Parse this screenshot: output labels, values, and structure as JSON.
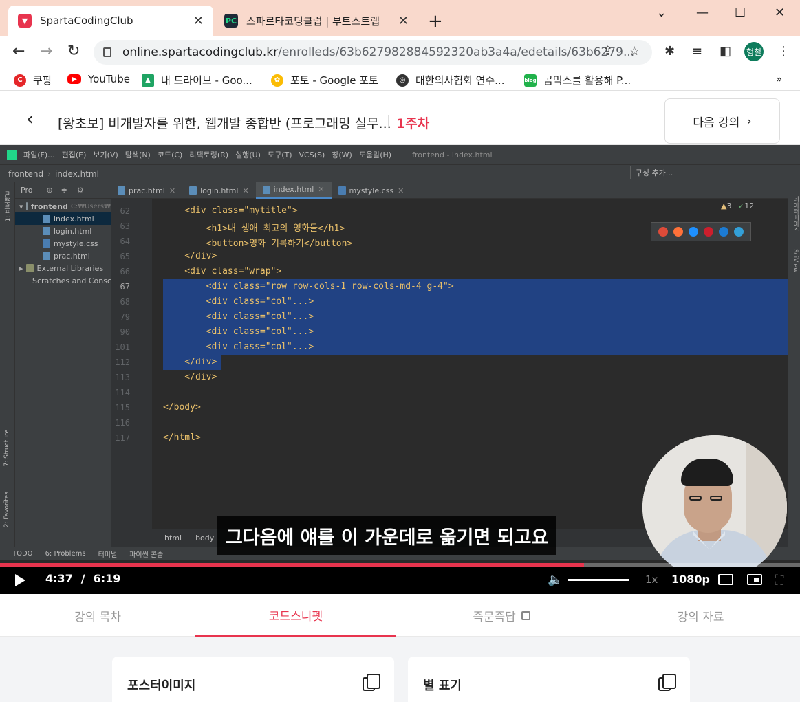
{
  "browser": {
    "tabs": [
      {
        "title": "SpartaCodingClub",
        "active": true
      },
      {
        "title": "스파르타코딩클럽 | 부트스트랩",
        "active": false
      }
    ],
    "url_host": "online.spartacodingclub.kr",
    "url_path": "/enrolleds/63b627982884592320ab3a4a/edetails/63b6279...",
    "profile_initial": "형철",
    "bookmarks": [
      "쿠팡",
      "YouTube",
      "내 드라이브 - Goo...",
      "포토 - Google 포토",
      "대한의사협회 연수...",
      "곰믹스를 활용해 P..."
    ],
    "more_bookmarks": "»"
  },
  "course": {
    "title": "[왕초보] 비개발자를 위한, 웹개발 종합반 (프로그래밍 실무...",
    "week": "1주차",
    "next_label": "다음 강의"
  },
  "ide": {
    "menu": [
      "파일(F)...",
      "편집(E)",
      "보기(V)",
      "탐색(N)",
      "코드(C)",
      "리팩토링(R)",
      "실행(U)",
      "도구(T)",
      "VCS(S)",
      "창(W)",
      "도움말(H)"
    ],
    "window_title": "frontend - index.html",
    "breadcrumb_project": "frontend",
    "breadcrumb_file": "index.html",
    "run_config": "구성 추가...",
    "project_label": "Pro",
    "tree": [
      {
        "label": "frontend",
        "hint": "C:₩Users₩",
        "level": 0
      },
      {
        "label": "index.html",
        "level": 1,
        "selected": true
      },
      {
        "label": "login.html",
        "level": 1
      },
      {
        "label": "mystyle.css",
        "level": 1
      },
      {
        "label": "prac.html",
        "level": 1
      },
      {
        "label": "External Libraries",
        "level": 0
      },
      {
        "label": "Scratches and Consc",
        "level": 0
      }
    ],
    "tabs": [
      "prac.html",
      "login.html",
      "index.html",
      "mystyle.css"
    ],
    "active_tab": "index.html",
    "warnings": "3",
    "checks": "12",
    "crumbs": [
      "html",
      "body"
    ],
    "bottom_tools": [
      "TODO",
      "6: Problems",
      "터미널",
      "파이썬 콘솔"
    ],
    "side_left": [
      "1: 프로젝트",
      "7: Structure",
      "2: Favorites"
    ],
    "side_right": [
      "데이터베이스",
      "SciView"
    ],
    "lines": [
      {
        "n": "62",
        "code": "    <div class=\"mytitle\">"
      },
      {
        "n": "63",
        "code": "        <h1>내 생애 최고의 영화들</h1>"
      },
      {
        "n": "64",
        "code": "        <button>영화 기록하기</button>"
      },
      {
        "n": "65",
        "code": "    </div>"
      },
      {
        "n": "66",
        "code": "    <div class=\"wrap\">"
      },
      {
        "n": "67",
        "code": "        <div class=\"row row-cols-1 row-cols-md-4 g-4\">"
      },
      {
        "n": "68",
        "code": "        <div class=\"col\"...>"
      },
      {
        "n": "79",
        "code": "        <div class=\"col\"...>"
      },
      {
        "n": "90",
        "code": "        <div class=\"col\"...>"
      },
      {
        "n": "101",
        "code": "        <div class=\"col\"...>"
      },
      {
        "n": "112",
        "code": "    </div>"
      },
      {
        "n": "113",
        "code": "    </div>"
      },
      {
        "n": "114",
        "code": ""
      },
      {
        "n": "115",
        "code": "</body>"
      },
      {
        "n": "116",
        "code": ""
      },
      {
        "n": "117",
        "code": "</html>"
      }
    ]
  },
  "video": {
    "subtitle": "그다음에 얘를 이 가운데로 옮기면 되고요",
    "current_time": "4:37",
    "time_sep": "/",
    "duration": "6:19",
    "progress_fraction": 0.73,
    "speed": "1x",
    "quality": "1080p"
  },
  "lecture_tabs": {
    "items": [
      "강의 목차",
      "코드스니펫",
      "즉문즉답",
      "강의 자료"
    ],
    "active_index": 1
  },
  "snippets": {
    "cards": [
      "포스터이미지",
      "별 표기"
    ]
  },
  "colors": {
    "accent": "#e8344e",
    "tabstrip": "#f9d9cc",
    "editor_bg": "#2b2b2b",
    "selection": "#214283"
  }
}
